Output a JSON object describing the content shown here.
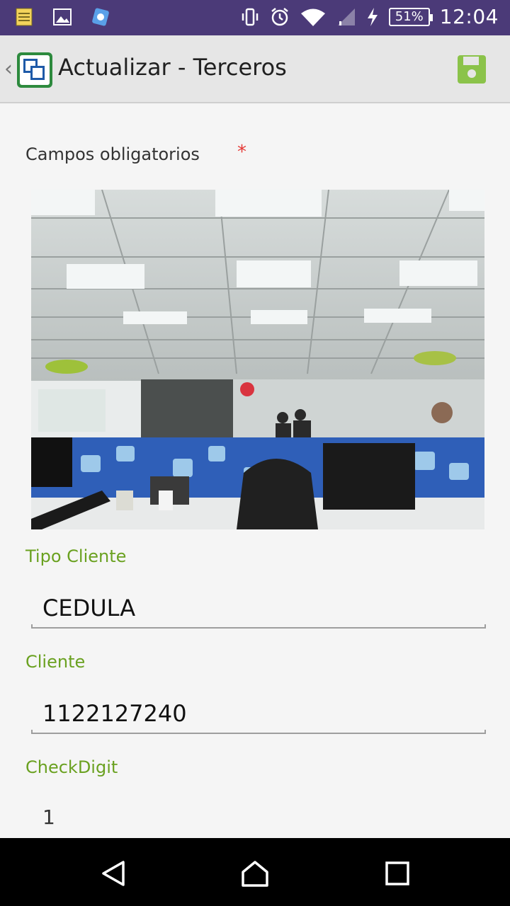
{
  "status_bar": {
    "icons_left": [
      "notes-icon",
      "image-icon",
      "app-icon"
    ],
    "icons_right": [
      "vibrate-icon",
      "alarm-icon",
      "wifi-icon",
      "signal-icon",
      "charging-icon"
    ],
    "battery": "51%",
    "time": "12:04",
    "background": "#4b3a78"
  },
  "app_bar": {
    "title": "Actualizar - Terceros",
    "save_icon": "save-icon",
    "accent": "#8bc34a"
  },
  "form": {
    "required_label": "Campos obligatorios",
    "required_marker": "*",
    "fields": [
      {
        "label": "Tipo Cliente",
        "value": "CEDULA"
      },
      {
        "label": "Cliente",
        "value": "1122127240"
      },
      {
        "label": "CheckDigit",
        "value": "1"
      }
    ],
    "label_color": "#6aa120"
  },
  "nav_bar": {
    "buttons": [
      "back-icon",
      "home-icon",
      "recents-icon"
    ]
  }
}
